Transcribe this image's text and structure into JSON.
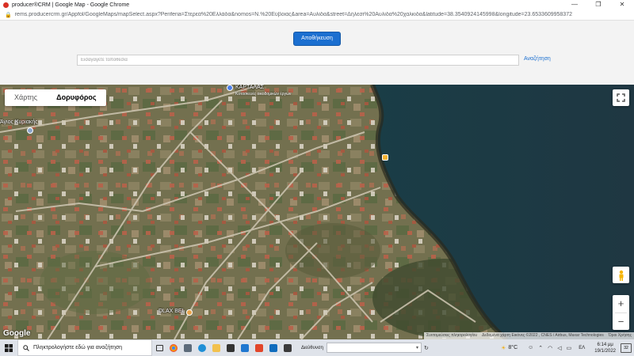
{
  "window": {
    "title": "producer®CRM | Google Map - Google Chrome",
    "controls": {
      "minimize": "—",
      "restore": "❐",
      "close": "✕"
    }
  },
  "addressbar": {
    "url": "rems.producercrm.gr/Appfol/GoogleMaps/mapSelect.aspx?Periferia=Στερεά%20Ελλάδα&nomos=Ν.%20Εύβοιας&area=Αυλίδα&street=Δήλεσι%20Αυλίδα%20χαλκιδα&latitude=38.3540924145998&longitude=23.6533609958372"
  },
  "page": {
    "save_label": "Αποθήκευση",
    "search_placeholder": "Εισαγάγετε τοποθεσία",
    "search_link": "Αναζήτηση"
  },
  "map": {
    "tabs": [
      {
        "label": "Χάρτης",
        "active": false
      },
      {
        "label": "Δορυφόρος",
        "active": true
      }
    ],
    "labels": {
      "poi": "ΚΑΡΤΑΛΑΣ",
      "poi_sub": "Κατασκευές οικοδομικών έργων",
      "area": "Άγιος Κυριακής",
      "poi2": "DLAX BEL"
    },
    "zoom_in": "+",
    "zoom_out": "−",
    "google_logo": "Google",
    "attribution": [
      "Συντομεύσεις πληκτρολογίου",
      "Δεδομένα χάρτη Εικόνες ©2022 , CNES / Airbus, Maxar Technologies",
      "Όροι Χρήσης"
    ]
  },
  "taskbar": {
    "search_text": "Πληκτρολογήστε εδώ για αναζήτηση",
    "address_label": "Διεύθυνση",
    "weather": "8°C",
    "language": "ΕΛ",
    "time": "6:14 μμ",
    "date": "19/1/2022",
    "notifications": "32"
  },
  "colors": {
    "accent": "#1b6fd0",
    "sea": "#1f3a45",
    "land": "#6d6a4f"
  }
}
